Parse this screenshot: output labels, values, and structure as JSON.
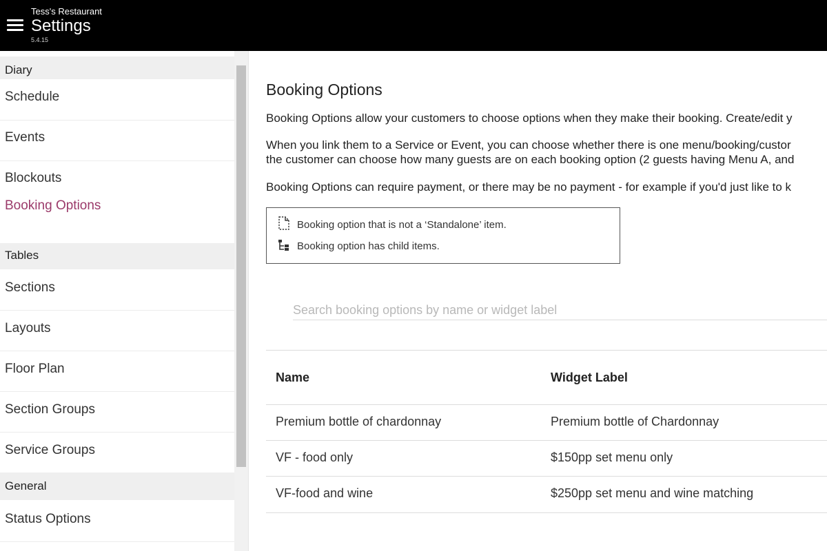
{
  "header": {
    "restaurant": "Tess's Restaurant",
    "title": "Settings",
    "version": "5.4.15",
    "menu_icon": "hamburger-menu-icon"
  },
  "sidebar": {
    "sections": [
      {
        "title": "Diary",
        "items": [
          "Schedule",
          "Events",
          "Blockouts",
          "Booking Options"
        ]
      },
      {
        "title": "Tables",
        "items": [
          "Sections",
          "Layouts",
          "Floor Plan",
          "Section Groups",
          "Service Groups"
        ]
      },
      {
        "title": "General",
        "items": [
          "Status Options"
        ]
      }
    ],
    "active_item": "Booking Options",
    "active_color": "#9b3a6a"
  },
  "main": {
    "title": "Booking Options",
    "paragraphs": [
      "Booking Options allow your customers to choose options when they make their booking. Create/edit y",
      "When you link them to a Service or Event, you can choose whether there is one menu/booking/custor",
      "the customer can choose how many guests are on each booking option (2 guests having Menu A, and",
      "Booking Options can require payment, or there may be no payment - for example if you'd just like to k"
    ],
    "legend": [
      {
        "icon": "dashed-document-icon",
        "text": "Booking option that is not a ‘Standalone’ item."
      },
      {
        "icon": "child-items-tree-icon",
        "text": "Booking option has child items."
      }
    ],
    "search_placeholder": "Search booking options by name or widget label",
    "search_value": "",
    "table": {
      "columns": [
        "Name",
        "Widget Label"
      ],
      "rows": [
        [
          "Premium bottle of chardonnay",
          "Premium bottle of Chardonnay"
        ],
        [
          "VF - food only",
          "$150pp set menu only"
        ],
        [
          "VF-food and wine",
          "$250pp set menu and wine matching"
        ]
      ]
    }
  }
}
